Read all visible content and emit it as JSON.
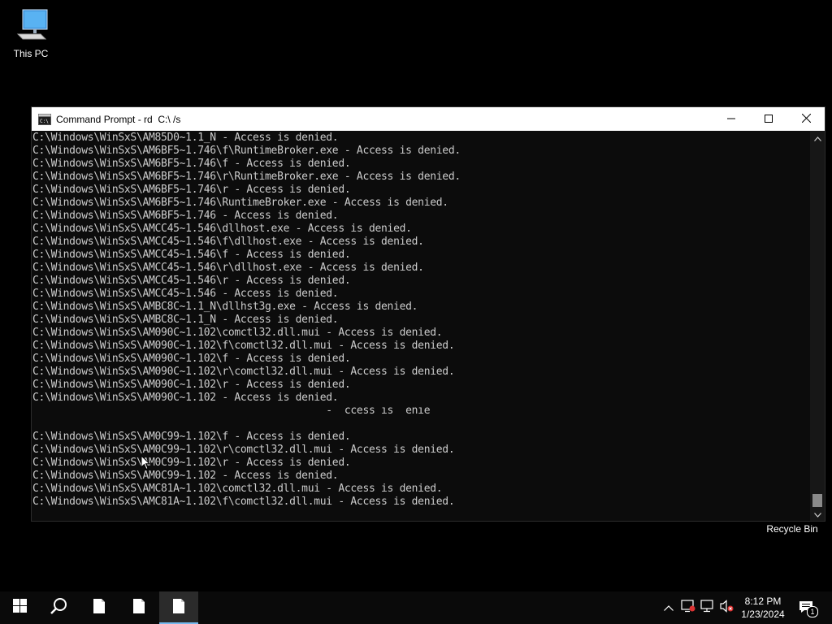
{
  "desktop": {
    "icons": [
      {
        "label": "This PC",
        "icon": "computer-icon"
      },
      {
        "label": "Recycle Bin",
        "icon": "recycle-bin-icon"
      }
    ]
  },
  "window": {
    "title": "Command Prompt - rd  C:\\ /s",
    "icon": "command-prompt-icon",
    "controls": {
      "minimize": "minimize-icon",
      "maximize": "maximize-icon",
      "close": "close-icon"
    },
    "colors": {
      "background": "#0c0c0c",
      "text": "#cccccc",
      "titlebar": "#ffffff"
    }
  },
  "console": {
    "lines": [
      "C:\\Windows\\WinSxS\\AM85D0~1.1_N - Access is denied.",
      "C:\\Windows\\WinSxS\\AM6BF5~1.746\\f\\RuntimeBroker.exe - Access is denied.",
      "C:\\Windows\\WinSxS\\AM6BF5~1.746\\f - Access is denied.",
      "C:\\Windows\\WinSxS\\AM6BF5~1.746\\r\\RuntimeBroker.exe - Access is denied.",
      "C:\\Windows\\WinSxS\\AM6BF5~1.746\\r - Access is denied.",
      "C:\\Windows\\WinSxS\\AM6BF5~1.746\\RuntimeBroker.exe - Access is denied.",
      "C:\\Windows\\WinSxS\\AM6BF5~1.746 - Access is denied.",
      "C:\\Windows\\WinSxS\\AMCC45~1.546\\dllhost.exe - Access is denied.",
      "C:\\Windows\\WinSxS\\AMCC45~1.546\\f\\dllhost.exe - Access is denied.",
      "C:\\Windows\\WinSxS\\AMCC45~1.546\\f - Access is denied.",
      "C:\\Windows\\WinSxS\\AMCC45~1.546\\r\\dllhost.exe - Access is denied.",
      "C:\\Windows\\WinSxS\\AMCC45~1.546\\r - Access is denied.",
      "C:\\Windows\\WinSxS\\AMCC45~1.546 - Access is denied.",
      "C:\\Windows\\WinSxS\\AMBC8C~1.1_N\\dllhst3g.exe - Access is denied.",
      "C:\\Windows\\WinSxS\\AMBC8C~1.1_N - Access is denied.",
      "C:\\Windows\\WinSxS\\AM090C~1.102\\comctl32.dll.mui - Access is denied.",
      "C:\\Windows\\WinSxS\\AM090C~1.102\\f\\comctl32.dll.mui - Access is denied.",
      "C:\\Windows\\WinSxS\\AM090C~1.102\\f - Access is denied.",
      "C:\\Windows\\WinSxS\\AM090C~1.102\\r\\comctl32.dll.mui - Access is denied.",
      "C:\\Windows\\WinSxS\\AM090C~1.102\\r - Access is denied.",
      "C:\\Windows\\WinSxS\\AM090C~1.102 - Access is denied.",
      "                                                -  ccess ıs  enıe",
      "",
      "C:\\Windows\\WinSxS\\AM0C99~1.102\\f - Access is denied.",
      "C:\\Windows\\WinSxS\\AM0C99~1.102\\r\\comctl32.dll.mui - Access is denied.",
      "C:\\Windows\\WinSxS\\AM0C99~1.102\\r - Access is denied.",
      "C:\\Windows\\WinSxS\\AM0C99~1.102 - Access is denied.",
      "C:\\Windows\\WinSxS\\AMC81A~1.102\\comctl32.dll.mui - Access is denied.",
      "C:\\Windows\\WinSxS\\AMC81A~1.102\\f\\comctl32.dll.mui - Access is denied."
    ]
  },
  "scrollbar": {
    "up": "chevron-up-icon",
    "down": "chevron-down-icon"
  },
  "taskbar": {
    "buttons": [
      {
        "name": "start-button",
        "icon": "windows-logo-icon"
      },
      {
        "name": "search-button",
        "icon": "search-icon"
      },
      {
        "name": "taskbar-file-1",
        "icon": "file-icon"
      },
      {
        "name": "taskbar-file-2",
        "icon": "file-icon"
      },
      {
        "name": "taskbar-file-3",
        "icon": "file-icon",
        "active": true
      }
    ],
    "tray": {
      "icons": [
        "chevron-up-icon",
        "security-icon",
        "network-icon",
        "volume-muted-icon"
      ],
      "time": "8:12 PM",
      "date": "1/23/2024",
      "notification_count": "1"
    }
  }
}
